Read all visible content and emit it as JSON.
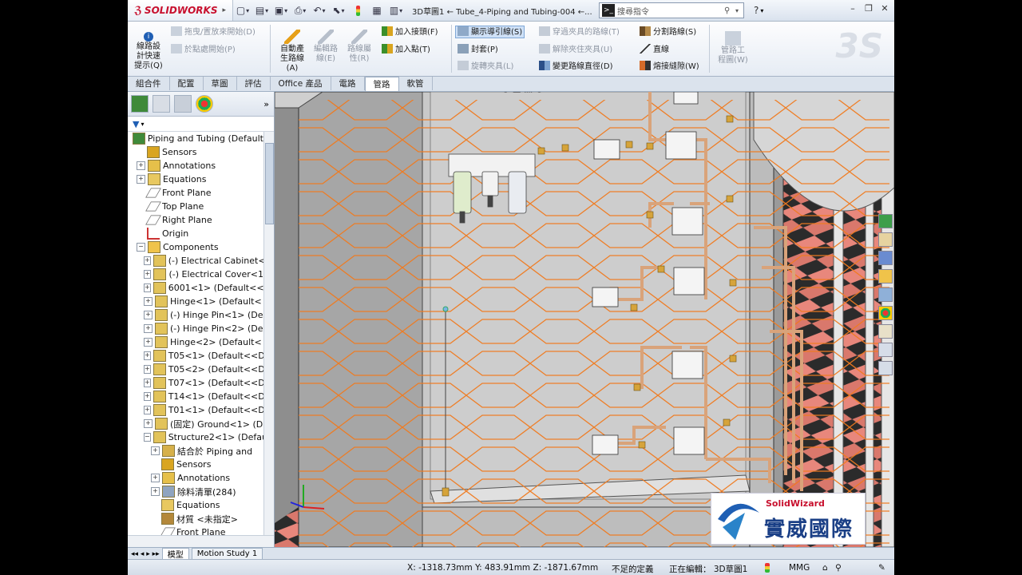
{
  "app": {
    "brand": "SOLIDWORKS",
    "document_title": "3D草圖1 ← Tube_4-Piping and Tubing-004 ←...",
    "command_search_placeholder": "搜尋指令",
    "help": "?"
  },
  "ribbon": {
    "routing_tips": "線路設\n計快速\n提示(Q)",
    "drag_drop_start": "拖曳/置放來開始(D)",
    "start_at_point": "於點處開始(P)",
    "auto_route": "自動產\n生路線\n(A)",
    "edit_route": "編輯路\n線(E)",
    "route_props": "路線屬\n性(R)",
    "add_fitting": "加入接頭(F)",
    "add_point": "加入點(T)",
    "show_guidelines": "顯示導引線(S)",
    "cap": "封套(P)",
    "rotate_clip": "旋轉夾具(L)",
    "route_thru_clip": "穿過夾具的路線(T)",
    "unclip": "解除夾住夾具(U)",
    "change_diameter": "變更路線直徑(D)",
    "split_route": "分割路線(S)",
    "line": "直線",
    "fillet_bend": "熔接縫隙(W)",
    "piping_drawing": "管路工\n程圖(W)"
  },
  "tabs": [
    "組合件",
    "配置",
    "草圖",
    "評估",
    "Office 產品",
    "電路",
    "管路",
    "軟管"
  ],
  "active_tab": "管路",
  "tree": [
    {
      "label": "Piping and Tubing  (Default",
      "level": 0,
      "exp": "",
      "icon": "assembly-icon"
    },
    {
      "label": "Sensors",
      "level": 1,
      "exp": "",
      "icon": "sensor-icon"
    },
    {
      "label": "Annotations",
      "level": 1,
      "exp": "+",
      "icon": "annotation-icon"
    },
    {
      "label": "Equations",
      "level": 1,
      "exp": "+",
      "icon": "equation-icon"
    },
    {
      "label": "Front Plane",
      "level": 1,
      "exp": "",
      "icon": "plane-icon"
    },
    {
      "label": "Top Plane",
      "level": 1,
      "exp": "",
      "icon": "plane-icon"
    },
    {
      "label": "Right Plane",
      "level": 1,
      "exp": "",
      "icon": "plane-icon"
    },
    {
      "label": "Origin",
      "level": 1,
      "exp": "",
      "icon": "origin-icon"
    },
    {
      "label": "Components",
      "level": 1,
      "exp": "−",
      "icon": "folder-icon"
    },
    {
      "label": "(-) Electrical Cabinet<",
      "level": 2,
      "exp": "+",
      "icon": "component-icon"
    },
    {
      "label": "(-) Electrical Cover<1",
      "level": 2,
      "exp": "+",
      "icon": "component-icon"
    },
    {
      "label": "6001<1> (Default<<",
      "level": 2,
      "exp": "+",
      "icon": "component-icon"
    },
    {
      "label": "Hinge<1> (Default<",
      "level": 2,
      "exp": "+",
      "icon": "component-icon"
    },
    {
      "label": "(-) Hinge Pin<1> (De",
      "level": 2,
      "exp": "+",
      "icon": "component-icon"
    },
    {
      "label": "(-) Hinge Pin<2> (De",
      "level": 2,
      "exp": "+",
      "icon": "component-icon"
    },
    {
      "label": "Hinge<2> (Default<",
      "level": 2,
      "exp": "+",
      "icon": "component-icon"
    },
    {
      "label": "T05<1> (Default<<D",
      "level": 2,
      "exp": "+",
      "icon": "component-icon"
    },
    {
      "label": "T05<2> (Default<<D",
      "level": 2,
      "exp": "+",
      "icon": "component-icon"
    },
    {
      "label": "T07<1> (Default<<D",
      "level": 2,
      "exp": "+",
      "icon": "component-icon"
    },
    {
      "label": "T14<1> (Default<<D",
      "level": 2,
      "exp": "+",
      "icon": "component-icon"
    },
    {
      "label": "T01<1> (Default<<D",
      "level": 2,
      "exp": "+",
      "icon": "component-icon"
    },
    {
      "label": "(固定) Ground<1> (D",
      "level": 2,
      "exp": "+",
      "icon": "component-icon"
    },
    {
      "label": "Structure2<1> (Defau",
      "level": 2,
      "exp": "−",
      "icon": "component-icon"
    },
    {
      "label": "結合於 Piping and",
      "level": 3,
      "exp": "+",
      "icon": "mate-icon"
    },
    {
      "label": "Sensors",
      "level": 3,
      "exp": "",
      "icon": "sensor-icon"
    },
    {
      "label": "Annotations",
      "level": 3,
      "exp": "+",
      "icon": "annotation-icon"
    },
    {
      "label": "除料清單(284)",
      "level": 3,
      "exp": "+",
      "icon": "cutlist-icon"
    },
    {
      "label": "Equations",
      "level": 3,
      "exp": "",
      "icon": "equation-icon"
    },
    {
      "label": "材質 <未指定>",
      "level": 3,
      "exp": "",
      "icon": "material-icon"
    },
    {
      "label": "Front Plane",
      "level": 3,
      "exp": "",
      "icon": "plane-icon"
    }
  ],
  "bottom_tabs": [
    "模型",
    "Motion Study 1"
  ],
  "status": {
    "coords": "X: -1318.73mm Y: 483.91mm Z: -1871.67mm",
    "definition": "不足的定義",
    "editing": "正在編輯： 3D草圖1",
    "units": "MMG"
  },
  "watermark": {
    "en": "SolidWizard",
    "zh": "實威國際"
  },
  "colors": {
    "guideline": "#f07a1e",
    "floor": "#e8877c",
    "accent": "#c8102e"
  }
}
